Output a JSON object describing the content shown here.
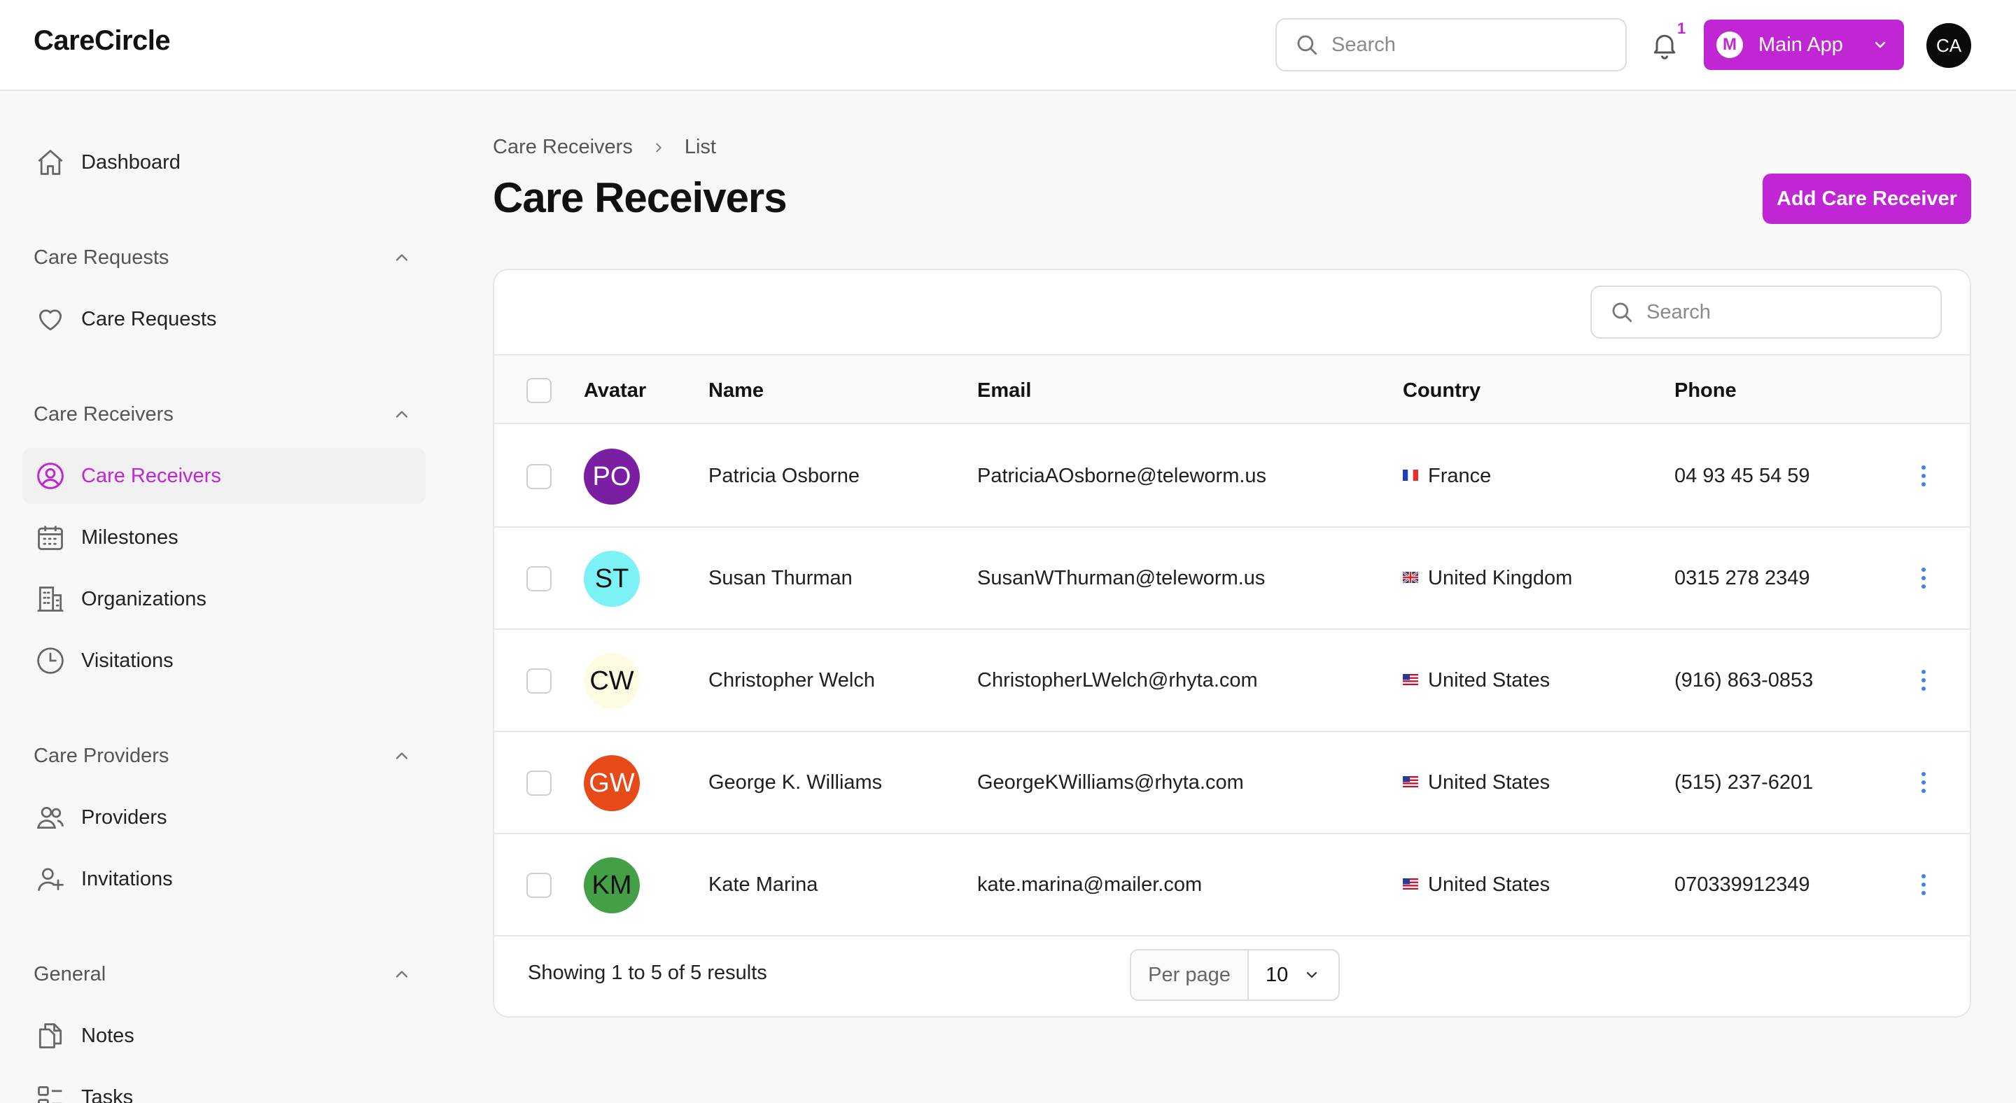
{
  "app": {
    "brand": "CareCircle",
    "search_placeholder": "Search",
    "notifications_count": "1",
    "app_switch_initial": "M",
    "app_switch_label": "Main App",
    "user_initials": "CA"
  },
  "colors": {
    "accent": "#c026d3"
  },
  "sidebar": {
    "dashboard": {
      "label": "Dashboard",
      "icon": "home-icon"
    },
    "groups": {
      "care_requests": {
        "label": "Care Requests",
        "items": [
          {
            "label": "Care Requests",
            "icon": "heart-icon"
          }
        ]
      },
      "care_receivers": {
        "label": "Care Receivers",
        "items": [
          {
            "label": "Care Receivers",
            "icon": "user-circle-icon",
            "active": true
          },
          {
            "label": "Milestones",
            "icon": "calendar-icon"
          },
          {
            "label": "Organizations",
            "icon": "building-icon"
          },
          {
            "label": "Visitations",
            "icon": "clock-icon"
          }
        ]
      },
      "care_providers": {
        "label": "Care Providers",
        "items": [
          {
            "label": "Providers",
            "icon": "users-icon"
          },
          {
            "label": "Invitations",
            "icon": "user-plus-icon"
          }
        ]
      },
      "general": {
        "label": "General",
        "items": [
          {
            "label": "Notes",
            "icon": "documents-icon"
          },
          {
            "label": "Tasks",
            "icon": "tasks-icon"
          }
        ]
      }
    }
  },
  "breadcrumb": {
    "parent": "Care Receivers",
    "current": "List"
  },
  "page": {
    "title": "Care Receivers",
    "add_button": "Add Care Receiver"
  },
  "table": {
    "search_placeholder": "Search",
    "columns": [
      "Avatar",
      "Name",
      "Email",
      "Country",
      "Phone"
    ],
    "rows": [
      {
        "initials": "PO",
        "avatar_bg": "#7b1fa2",
        "avatar_fg": "#ffffff",
        "name": "Patricia Osborne",
        "email": "PatriciaAOsborne@teleworm.us",
        "flag": "fr",
        "country": "France",
        "phone": "04 93 45 54 59"
      },
      {
        "initials": "ST",
        "avatar_bg": "#7cf2f7",
        "avatar_fg": "#111111",
        "name": "Susan Thurman",
        "email": "SusanWThurman@teleworm.us",
        "flag": "gb",
        "country": "United Kingdom",
        "phone": "0315 278 2349"
      },
      {
        "initials": "CW",
        "avatar_bg": "#fefbe3",
        "avatar_fg": "#111111",
        "name": "Christopher Welch",
        "email": "ChristopherLWelch@rhyta.com",
        "flag": "us",
        "country": "United States",
        "phone": "(916) 863-0853"
      },
      {
        "initials": "GW",
        "avatar_bg": "#e64a19",
        "avatar_fg": "#ffffff",
        "name": "George K. Williams",
        "email": "GeorgeKWilliams@rhyta.com",
        "flag": "us",
        "country": "United States",
        "phone": "(515) 237-6201"
      },
      {
        "initials": "KM",
        "avatar_bg": "#43a047",
        "avatar_fg": "#111111",
        "name": "Kate Marina",
        "email": "kate.marina@mailer.com",
        "flag": "us",
        "country": "United States",
        "phone": "070339912349"
      }
    ],
    "footer": {
      "summary": "Showing 1 to 5 of 5 results",
      "per_page_label": "Per page",
      "per_page_value": "10"
    }
  }
}
